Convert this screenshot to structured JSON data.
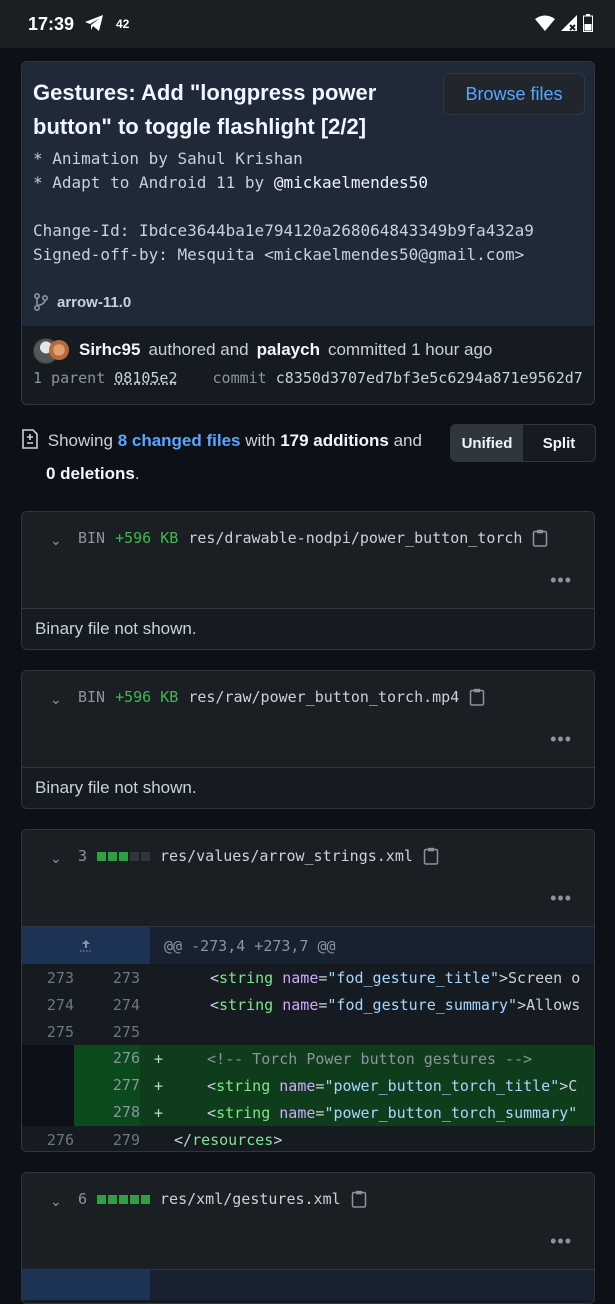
{
  "status_bar": {
    "time": "17:39",
    "notification_count": "42"
  },
  "commit": {
    "title": "Gestures: Add \"longpress power button\" to toggle flashlight [2/2]",
    "browse_label": "Browse files",
    "message_line1": "* Animation by Sahul Krishan",
    "message_line2_prefix": "* Adapt to Android 11 by ",
    "message_line2_user": "@mickaelmendes50",
    "change_id": "Change-Id: Ibdce3644ba1e794120a268064843349b9fa432a9",
    "signed_off": "Signed-off-by: Mesquita <mickaelmendes50@gmail.com>",
    "branch": "arrow-11.0",
    "author": "Sirhc95",
    "authored_text": "authored and",
    "committer": "palaych",
    "committed_text": "committed 1 hour ago",
    "parent_label": "1 parent",
    "parent_sha": "08105e2",
    "commit_label": "commit",
    "commit_sha": "c8350d3707ed7bf3e5c6294a871e9562d7"
  },
  "summary": {
    "showing": "Showing",
    "changed_files": "8 changed files",
    "with": "with",
    "additions": "179 additions",
    "and": "and",
    "deletions": "0 deletions",
    "period": ".",
    "unified_label": "Unified",
    "split_label": "Split"
  },
  "files": [
    {
      "type": "BIN",
      "size": "+596 KB",
      "path": "res/drawable-nodpi/power_button_torch",
      "note": "Binary file not shown."
    },
    {
      "type": "BIN",
      "size": "+596 KB",
      "path": "res/raw/power_button_torch.mp4",
      "note": "Binary file not shown."
    },
    {
      "count": "3",
      "path": "res/values/arrow_strings.xml",
      "hunk": "@@ -273,4 +273,7 @@",
      "lines": [
        {
          "old": "273",
          "new": "273",
          "sign": "",
          "indent": "    ",
          "tag": "string",
          "attr": "name",
          "val": "\"fod_gesture_title\"",
          "rest": ">Screen o"
        },
        {
          "old": "274",
          "new": "274",
          "sign": "",
          "indent": "    ",
          "tag": "string",
          "attr": "name",
          "val": "\"fod_gesture_summary\"",
          "rest": ">Allows"
        },
        {
          "old": "275",
          "new": "275",
          "sign": "",
          "blank": true
        },
        {
          "old": "",
          "new": "276",
          "sign": "+",
          "indent": "    ",
          "comment": "<!-- Torch Power button gestures -->"
        },
        {
          "old": "",
          "new": "277",
          "sign": "+",
          "indent": "    ",
          "tag": "string",
          "attr": "name",
          "val": "\"power_button_torch_title\"",
          "rest": ">C"
        },
        {
          "old": "",
          "new": "278",
          "sign": "+",
          "indent": "    ",
          "tag": "string",
          "attr": "name",
          "val": "\"power_button_torch_summary\"",
          "rest": ""
        },
        {
          "old": "276",
          "new": "279",
          "sign": "",
          "indent": "",
          "close": "resources"
        }
      ]
    },
    {
      "count": "6",
      "path": "res/xml/gestures.xml"
    }
  ]
}
